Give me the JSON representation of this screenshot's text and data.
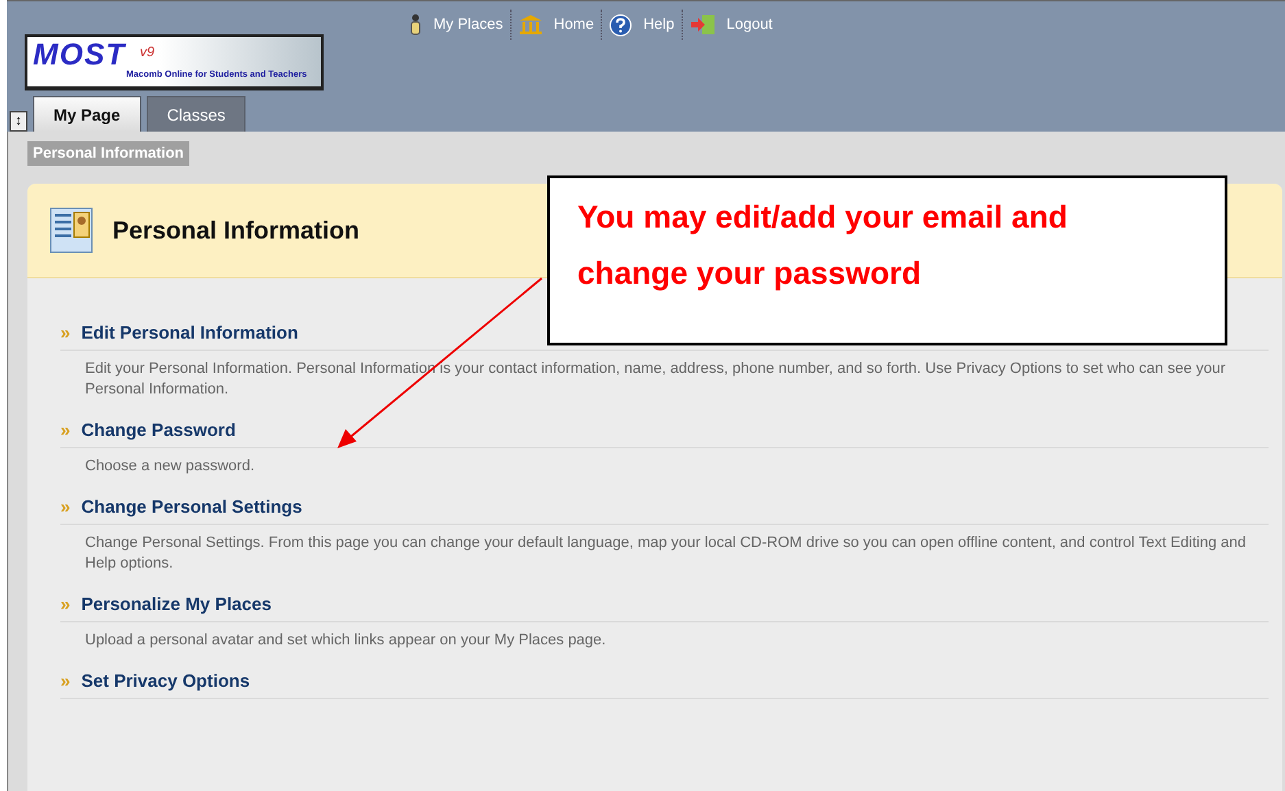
{
  "logo": {
    "name": "MOST",
    "version": "v9",
    "tagline": "Macomb Online for Students and Teachers"
  },
  "top_links": [
    {
      "label": "My Places",
      "kind": "person"
    },
    {
      "label": "Home",
      "kind": "building"
    },
    {
      "label": "Help",
      "kind": "help"
    },
    {
      "label": "Logout",
      "kind": "exit"
    }
  ],
  "collapse_toggle": "↕",
  "tabs": [
    {
      "label": "My Page",
      "selected": true
    },
    {
      "label": "Classes",
      "selected": false
    }
  ],
  "breadcrumb": "Personal Information",
  "panel": {
    "title": "Personal Information",
    "items": [
      {
        "title": "Edit Personal Information",
        "description": "Edit your Personal Information. Personal Information is your contact information, name, address, phone number, and so forth. Use Privacy Options to set who can see your Personal Information."
      },
      {
        "title": "Change Password",
        "description": "Choose a new password."
      },
      {
        "title": "Change Personal Settings",
        "description": "Change Personal Settings. From this page you can change your default language, map your local CD-ROM drive so you can open offline content, and control Text Editing and Help options."
      },
      {
        "title": "Personalize My Places",
        "description": "Upload a personal avatar and set which links appear on your My Places page."
      },
      {
        "title": "Set Privacy Options"
      }
    ]
  },
  "callout": {
    "text": "You may edit/add your email and change your password"
  },
  "bullet": "»"
}
